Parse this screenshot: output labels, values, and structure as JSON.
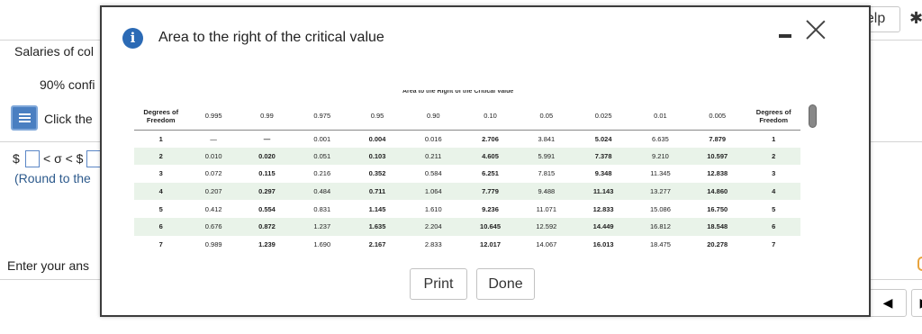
{
  "background": {
    "help_label": "n Help",
    "course_title": "Salaries of col",
    "confidence": "90% confi",
    "click_text": "Click the",
    "interval_dollar1": "$",
    "interval_symbols": "< σ < $",
    "round_text": "(Round to the",
    "enter_text": "Enter your ans",
    "prev_arrow": "◀",
    "next_arrow": "▶"
  },
  "dialog": {
    "title": "Area to the right of the critical value",
    "info_glyph": "i",
    "table_caption": "Area to the Right of the Critical Value",
    "print_label": "Print",
    "done_label": "Done"
  },
  "table": {
    "header_left": "Degrees of Freedom",
    "header_right": "Degrees of Freedom",
    "areas": [
      "0.995",
      "0.99",
      "0.975",
      "0.95",
      "0.90",
      "0.10",
      "0.05",
      "0.025",
      "0.01",
      "0.005"
    ],
    "rows": [
      {
        "df": "1",
        "values": [
          "—",
          "—",
          "0.001",
          "0.004",
          "0.016",
          "2.706",
          "3.841",
          "5.024",
          "6.635",
          "7.879"
        ]
      },
      {
        "df": "2",
        "values": [
          "0.010",
          "0.020",
          "0.051",
          "0.103",
          "0.211",
          "4.605",
          "5.991",
          "7.378",
          "9.210",
          "10.597"
        ]
      },
      {
        "df": "3",
        "values": [
          "0.072",
          "0.115",
          "0.216",
          "0.352",
          "0.584",
          "6.251",
          "7.815",
          "9.348",
          "11.345",
          "12.838"
        ]
      },
      {
        "df": "4",
        "values": [
          "0.207",
          "0.297",
          "0.484",
          "0.711",
          "1.064",
          "7.779",
          "9.488",
          "11.143",
          "13.277",
          "14.860"
        ]
      },
      {
        "df": "5",
        "values": [
          "0.412",
          "0.554",
          "0.831",
          "1.145",
          "1.610",
          "9.236",
          "11.071",
          "12.833",
          "15.086",
          "16.750"
        ]
      },
      {
        "df": "6",
        "values": [
          "0.676",
          "0.872",
          "1.237",
          "1.635",
          "2.204",
          "10.645",
          "12.592",
          "14.449",
          "16.812",
          "18.548"
        ]
      },
      {
        "df": "7",
        "values": [
          "0.989",
          "1.239",
          "1.690",
          "2.167",
          "2.833",
          "12.017",
          "14.067",
          "16.013",
          "18.475",
          "20.278"
        ]
      }
    ]
  }
}
